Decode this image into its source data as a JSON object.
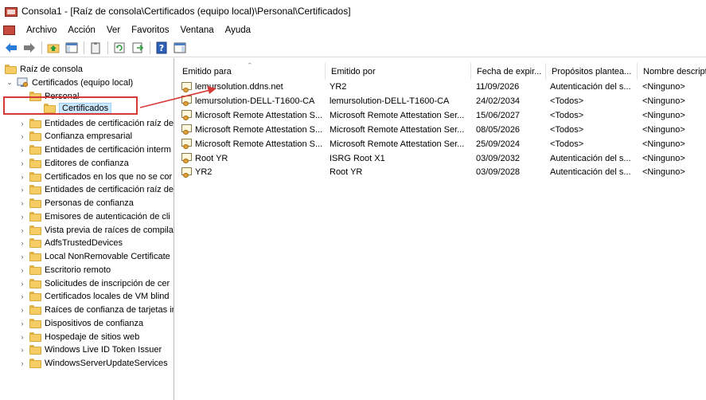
{
  "window": {
    "title": "Consola1 - [Raíz de consola\\Certificados (equipo local)\\Personal\\Certificados]"
  },
  "menu": {
    "items": [
      "Archivo",
      "Acción",
      "Ver",
      "Favoritos",
      "Ventana",
      "Ayuda"
    ]
  },
  "toolbar": {
    "icons": [
      "back-arrow-icon",
      "forward-arrow-icon",
      "up-folder-icon",
      "show-hide-tree-icon",
      "clipboard-icon",
      "refresh-icon",
      "export-list-icon",
      "help-icon",
      "properties-pane-icon"
    ]
  },
  "tree": {
    "root": "Raíz de consola",
    "cert_store": "Certificados (equipo local)",
    "personal": "Personal",
    "certificados": "Certificados",
    "items": [
      "Entidades de certificación raíz de",
      "Confianza empresarial",
      "Entidades de certificación interm",
      "Editores de confianza",
      "Certificados en los que no se cor",
      "Entidades de certificación raíz de",
      "Personas de confianza",
      "Emisores de autenticación de cli",
      "Vista previa de raíces de compila",
      "AdfsTrustedDevices",
      "Local NonRemovable Certificate",
      "Escritorio remoto",
      "Solicitudes de inscripción de cer",
      "Certificados locales de VM blind",
      "Raíces de confianza de tarjetas ir",
      "Dispositivos de confianza",
      "Hospedaje de sitios web",
      "Windows Live ID Token Issuer",
      "WindowsServerUpdateServices"
    ]
  },
  "list": {
    "columns": [
      "Emitido para",
      "Emitido por",
      "Fecha de expir...",
      "Propósitos plantea...",
      "Nombre descript"
    ],
    "rows": [
      [
        "lemursolution.ddns.net",
        "YR2",
        "11/09/2026",
        "Autenticación del s...",
        "<Ninguno>"
      ],
      [
        "lemursolution-DELL-T1600-CA",
        "lemursolution-DELL-T1600-CA",
        "24/02/2034",
        "<Todos>",
        "<Ninguno>"
      ],
      [
        "Microsoft Remote Attestation S...",
        "Microsoft Remote Attestation Ser...",
        "15/06/2027",
        "<Todos>",
        "<Ninguno>"
      ],
      [
        "Microsoft Remote Attestation S...",
        "Microsoft Remote Attestation Ser...",
        "08/05/2026",
        "<Todos>",
        "<Ninguno>"
      ],
      [
        "Microsoft Remote Attestation S...",
        "Microsoft Remote Attestation Ser...",
        "25/09/2024",
        "<Todos>",
        "<Ninguno>"
      ],
      [
        "Root YR",
        "ISRG Root X1",
        "03/09/2032",
        "Autenticación del s...",
        "<Ninguno>"
      ],
      [
        "YR2",
        "Root YR",
        "03/09/2028",
        "Autenticación del s...",
        "<Ninguno>"
      ]
    ]
  },
  "colors": {
    "highlight_box": "#d63a37",
    "annotation_arrow": "#d63a37",
    "selection": "#cce8ff",
    "folder": "#f5cd64"
  }
}
